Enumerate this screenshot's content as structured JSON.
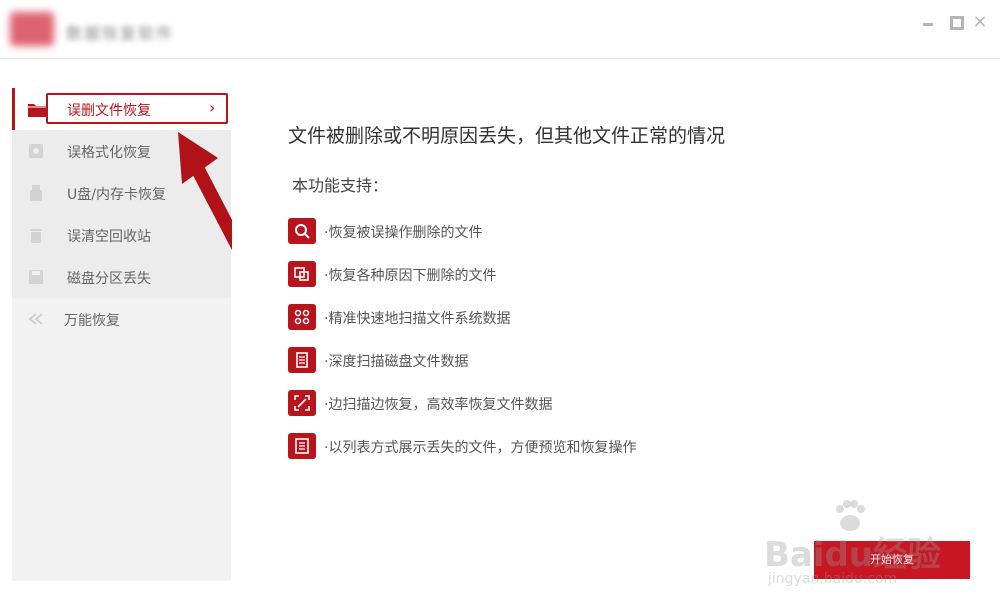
{
  "window": {
    "title": "数据恢复软件",
    "controls": {
      "minimize": "–",
      "maximize": "□",
      "close": "×"
    }
  },
  "sidebar": {
    "items": [
      {
        "label": "误删文件恢复",
        "icon": "folder-icon",
        "active": true
      },
      {
        "label": "误格式化恢复",
        "icon": "disk-icon"
      },
      {
        "label": "U盘/内存卡恢复",
        "icon": "usb-icon"
      },
      {
        "label": "误清空回收站",
        "icon": "trash-icon"
      },
      {
        "label": "磁盘分区丢失",
        "icon": "save-icon"
      },
      {
        "label": "万能恢复",
        "icon": "double-arrow-icon"
      }
    ],
    "active_chevron": "›"
  },
  "main": {
    "headline": "文件被删除或不明原因丢失，但其他文件正常的情况",
    "subhead": "本功能支持：",
    "features": [
      {
        "text": "·恢复被误操作删除的文件",
        "icon": "search-icon"
      },
      {
        "text": "·恢复各种原因下删除的文件",
        "icon": "copy-icon"
      },
      {
        "text": "·精准快速地扫描文件系统数据",
        "icon": "grid-icon"
      },
      {
        "text": "·深度扫描磁盘文件数据",
        "icon": "document-icon"
      },
      {
        "text": "·边扫描边恢复，高效率恢复文件数据",
        "icon": "scan-icon"
      },
      {
        "text": "·以列表方式展示丢失的文件，方便预览和恢复操作",
        "icon": "list-icon"
      }
    ],
    "start_button": "开始恢复"
  },
  "watermark": {
    "brand": "Baidu经验",
    "url": "jingyan.baidu.com"
  },
  "colors": {
    "accent": "#b8141c",
    "button": "#c81623",
    "sidebar_bg": "#f2f2f2"
  }
}
